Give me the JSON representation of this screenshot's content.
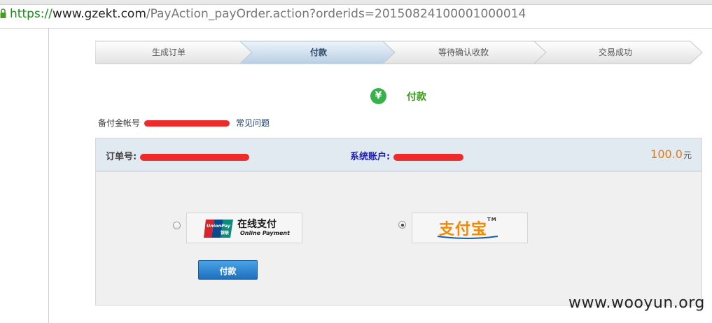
{
  "browser": {
    "url_scheme": "https://",
    "url_host": "www.gzekt.com",
    "url_path": "/PayAction_payOrder.action?orderids=2015082410000100001​4"
  },
  "steps": [
    {
      "label": "生成订单",
      "active": false
    },
    {
      "label": "付款",
      "active": true
    },
    {
      "label": "等待确认收款",
      "active": false
    },
    {
      "label": "交易成功",
      "active": false
    }
  ],
  "pay_header": {
    "icon": "yen-icon",
    "title": "付款"
  },
  "account": {
    "label": "备付金帐号",
    "faq_link": "常见问题"
  },
  "order": {
    "order_label": "订单号:",
    "system_account_label": "系统账户:",
    "amount": "100.0",
    "unit": "元"
  },
  "payment_methods": [
    {
      "name": "unionpay",
      "cn": "在线支付",
      "en": "Online Payment",
      "logo_top": "UnionPay",
      "logo_bottom": "银联",
      "selected": false
    },
    {
      "name": "alipay",
      "text": "支付宝",
      "tm": "TM",
      "selected": true
    }
  ],
  "pay_button": "付款",
  "watermark": "www.wooyun.org",
  "colors": {
    "accent_green": "#3a9a1e",
    "amount_orange": "#e07a13",
    "button_blue": "#1f6fc0",
    "redaction_red": "#ee2b2b"
  }
}
